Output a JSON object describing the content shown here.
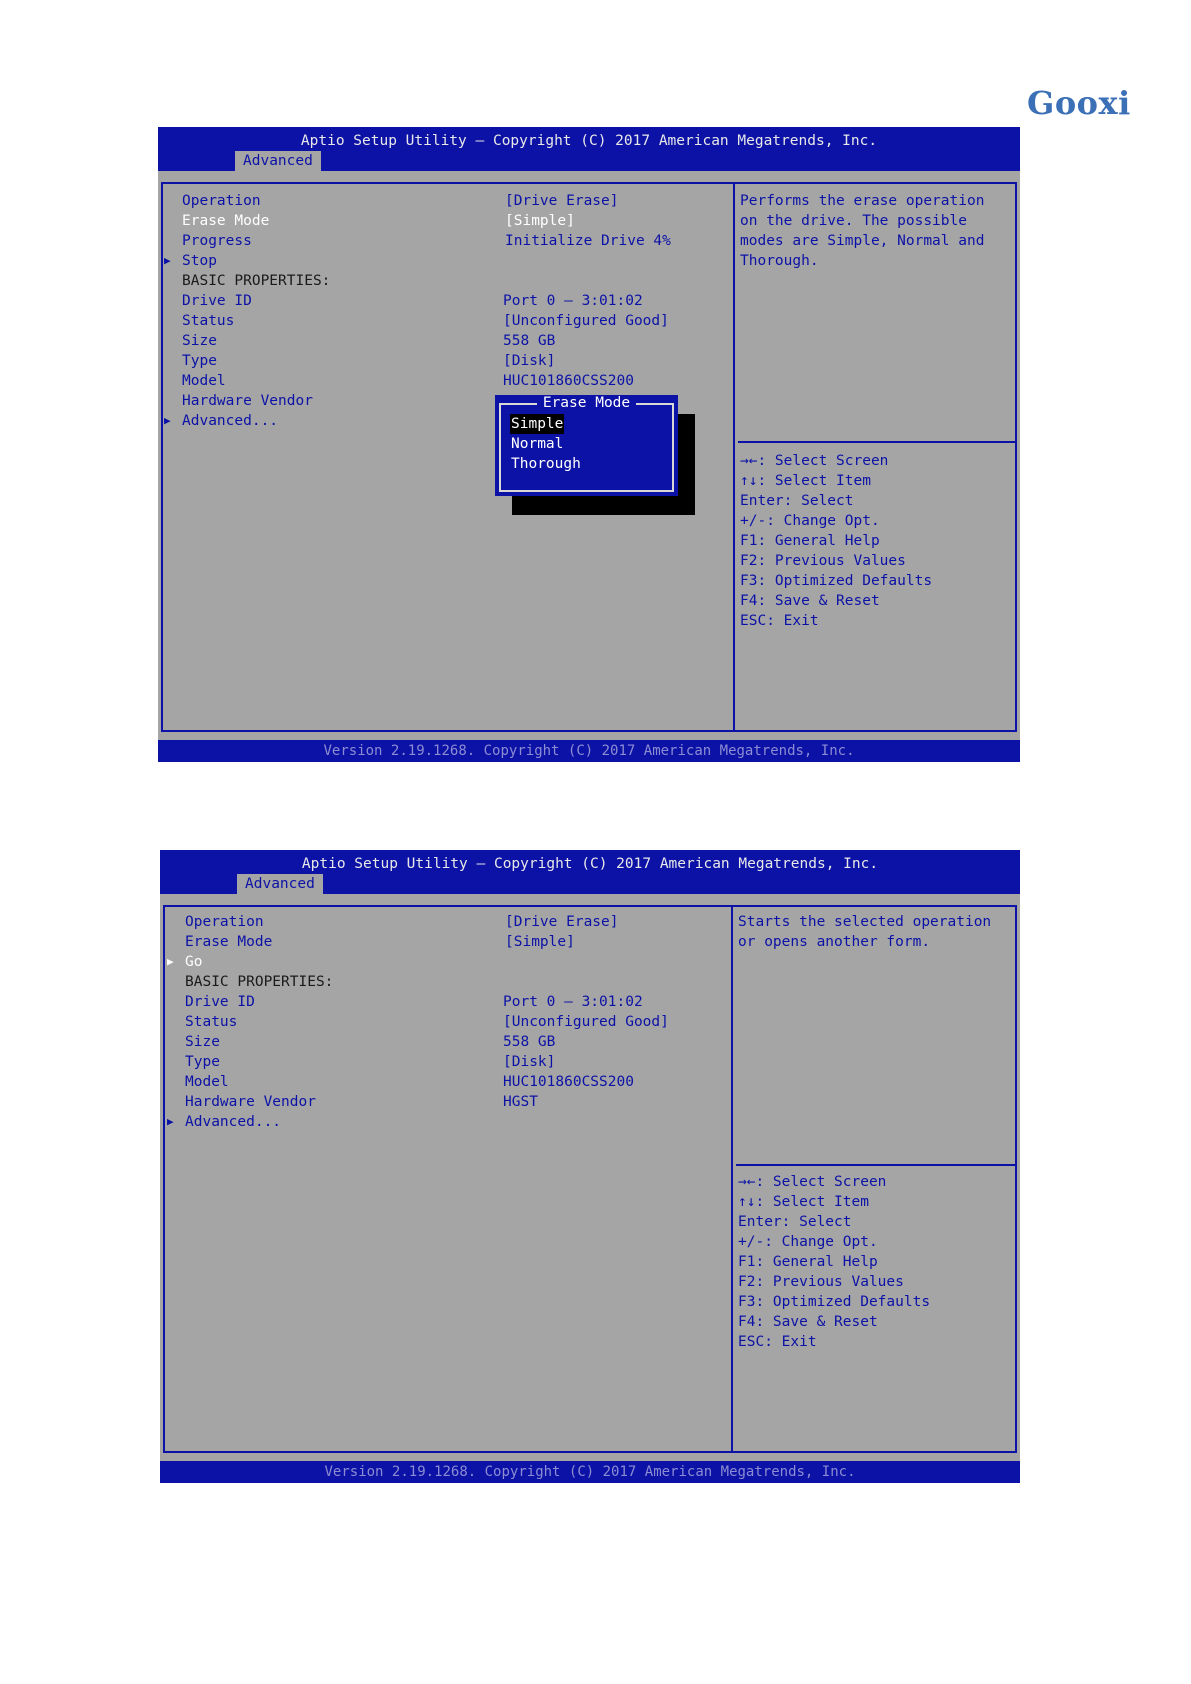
{
  "brand": {
    "logo_text": "Gooxi"
  },
  "screen1": {
    "title": "Aptio Setup Utility – Copyright (C) 2017 American Megatrends, Inc.",
    "tab": "Advanced",
    "items": [
      {
        "label": "Operation",
        "value": "[Drive Erase]"
      },
      {
        "label": "Erase Mode",
        "value": "[Simple]"
      },
      {
        "label": "Progress",
        "value": "Initialize Drive 4%"
      },
      {
        "label": "Stop",
        "value": ""
      },
      {
        "label": "BASIC PROPERTIES:",
        "value": ""
      },
      {
        "label": "Drive ID",
        "value": "Port 0 – 3:01:02"
      },
      {
        "label": "Status",
        "value": "[Unconfigured Good]"
      },
      {
        "label": "Size",
        "value": "558 GB"
      },
      {
        "label": "Type",
        "value": "[Disk]"
      },
      {
        "label": "Model",
        "value": "HUC101860CSS200"
      },
      {
        "label": "Hardware Vendor",
        "value": ""
      },
      {
        "label": "Advanced...",
        "value": ""
      }
    ],
    "help": [
      "Performs the erase operation",
      "on the drive. The possible",
      "modes are Simple, Normal and",
      "Thorough."
    ],
    "keys": [
      "→←: Select Screen",
      "↑↓: Select Item",
      "Enter: Select",
      "+/-: Change Opt.",
      "F1: General Help",
      "F2: Previous Values",
      "F3: Optimized Defaults",
      "F4: Save & Reset",
      "ESC: Exit"
    ],
    "popup": {
      "title": "Erase Mode",
      "options": [
        "Simple",
        "Normal",
        "Thorough"
      ],
      "selected": "Simple"
    },
    "footer": "Version 2.19.1268. Copyright (C) 2017 American Megatrends, Inc."
  },
  "screen2": {
    "title": "Aptio Setup Utility – Copyright (C) 2017 American Megatrends, Inc.",
    "tab": "Advanced",
    "items": [
      {
        "label": "Operation",
        "value": "[Drive Erase]"
      },
      {
        "label": "Erase Mode",
        "value": "[Simple]"
      },
      {
        "label": "Go",
        "value": ""
      },
      {
        "label": "BASIC PROPERTIES:",
        "value": ""
      },
      {
        "label": "Drive ID",
        "value": "Port 0 – 3:01:02"
      },
      {
        "label": "Status",
        "value": "[Unconfigured Good]"
      },
      {
        "label": "Size",
        "value": "558 GB"
      },
      {
        "label": "Type",
        "value": "[Disk]"
      },
      {
        "label": "Model",
        "value": "HUC101860CSS200"
      },
      {
        "label": "Hardware Vendor",
        "value": "HGST"
      },
      {
        "label": "Advanced...",
        "value": ""
      }
    ],
    "help": [
      "Starts the selected operation",
      "or opens another form."
    ],
    "keys": [
      "→←: Select Screen",
      "↑↓: Select Item",
      "Enter: Select",
      "+/-: Change Opt.",
      "F1: General Help",
      "F2: Previous Values",
      "F3: Optimized Defaults",
      "F4: Save & Reset",
      "ESC: Exit"
    ],
    "footer": "Version 2.19.1268. Copyright (C) 2017 American Megatrends, Inc."
  }
}
